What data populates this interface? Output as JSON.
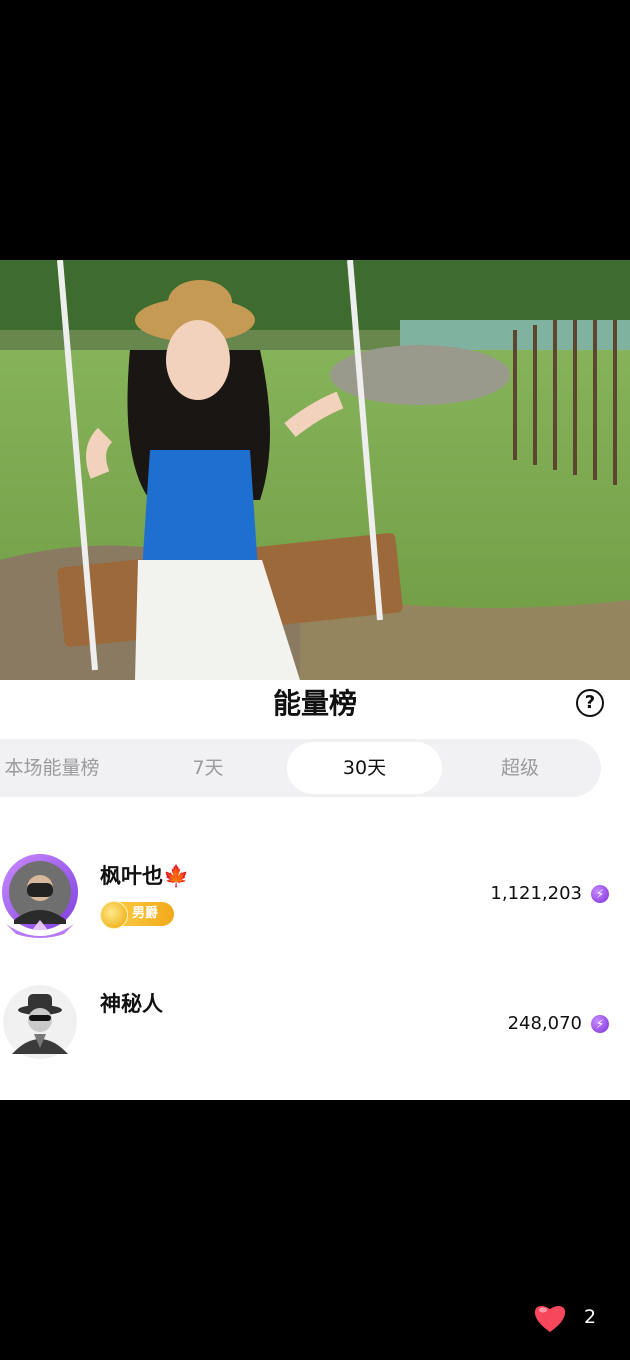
{
  "panel": {
    "title": "能量榜",
    "help_label": "?"
  },
  "tabs": [
    {
      "label": "本场能量榜",
      "active": false
    },
    {
      "label": "7天",
      "active": false
    },
    {
      "label": "30天",
      "active": true
    },
    {
      "label": "超级",
      "active": false
    }
  ],
  "leaderboard": [
    {
      "name": "枫叶也🍁",
      "badge": "男爵",
      "score": "1,121,203",
      "icon": "energy-bolt-icon"
    },
    {
      "name": "神秘人",
      "score": "248,070",
      "icon": "energy-bolt-icon"
    }
  ],
  "like": {
    "count": "2",
    "icon": "heart-icon",
    "color": "#f6475d"
  },
  "colors": {
    "energy": "#8a3cf0",
    "badge": "#f2a91b",
    "tab_bg": "#f1f1f3"
  }
}
